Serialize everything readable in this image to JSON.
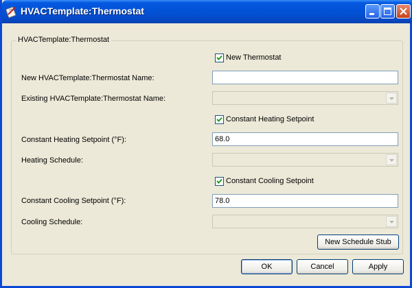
{
  "window": {
    "title": "HVACTemplate:Thermostat",
    "controls": [
      "minimize-icon",
      "maximize-icon",
      "close-icon"
    ]
  },
  "group": {
    "title": "HVACTemplate:Thermostat"
  },
  "form": {
    "new_thermostat_checkbox": {
      "label": "New Thermostat",
      "checked": true
    },
    "new_name": {
      "label": "New HVACTemplate:Thermostat Name:",
      "value": ""
    },
    "existing_name": {
      "label": "Existing HVACTemplate:Thermostat Name:",
      "value": "",
      "enabled": false
    },
    "constant_heating_checkbox": {
      "label": "Constant Heating Setpoint",
      "checked": true
    },
    "heating_setpoint": {
      "label": "Constant Heating Setpoint (°F):",
      "value": "68.0"
    },
    "heating_schedule": {
      "label": "Heating Schedule:",
      "value": "",
      "enabled": false
    },
    "constant_cooling_checkbox": {
      "label": "Constant Cooling Setpoint",
      "checked": true
    },
    "cooling_setpoint": {
      "label": "Constant Cooling Setpoint (°F):",
      "value": "78.0"
    },
    "cooling_schedule": {
      "label": "Cooling Schedule:",
      "value": "",
      "enabled": false
    }
  },
  "buttons": {
    "new_schedule_stub": "New Schedule Stub",
    "ok": "OK",
    "cancel": "Cancel",
    "apply": "Apply"
  },
  "colors": {
    "titlebar": "#0351d4",
    "dialog_bg": "#ece9d8",
    "button_border": "#003c74"
  }
}
